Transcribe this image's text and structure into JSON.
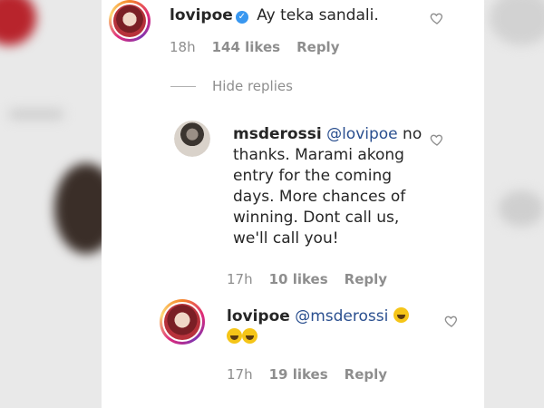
{
  "comments": [
    {
      "username": "lovipoe",
      "verified": true,
      "text": "Ay teka sandali.",
      "time": "18h",
      "likes": "144 likes",
      "reply": "Reply"
    },
    {
      "username": "msderossi",
      "mention": "@lovipoe",
      "text_lines": [
        "no",
        "thanks. Marami akong",
        "entry for the coming",
        "days. More chances of",
        "winning. Dont call us,",
        "we'll call you!"
      ],
      "time": "17h",
      "likes": "10 likes",
      "reply": "Reply"
    },
    {
      "username": "lovipoe",
      "mention": "@msderossi",
      "emoji": "grinning-sweat-emoji",
      "time": "17h",
      "likes": "19 likes",
      "reply": "Reply"
    }
  ],
  "hide_replies": "Hide replies",
  "colors": {
    "mention": "#2a4f8f",
    "meta": "#8e8e8e",
    "verified": "#3897f0"
  }
}
